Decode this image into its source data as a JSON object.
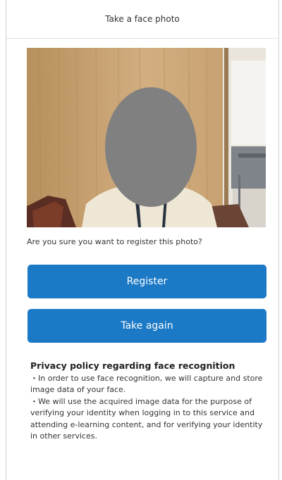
{
  "header": {
    "title": "Take a face photo"
  },
  "photo": {
    "face_mask_color": "#808080"
  },
  "question": "Are you sure you want to register this photo?",
  "buttons": {
    "register": "Register",
    "take_again": "Take again"
  },
  "colors": {
    "button": "#1b79c5"
  },
  "privacy": {
    "title": "Privacy policy regarding face recognition",
    "items": [
      "・In order to use face recognition, we will capture and store image data of your face.",
      "・We will use the acquired image data for the purpose of verifying your identity when logging in to this service and attending e-learning content, and for verifying your identity in other services."
    ]
  }
}
